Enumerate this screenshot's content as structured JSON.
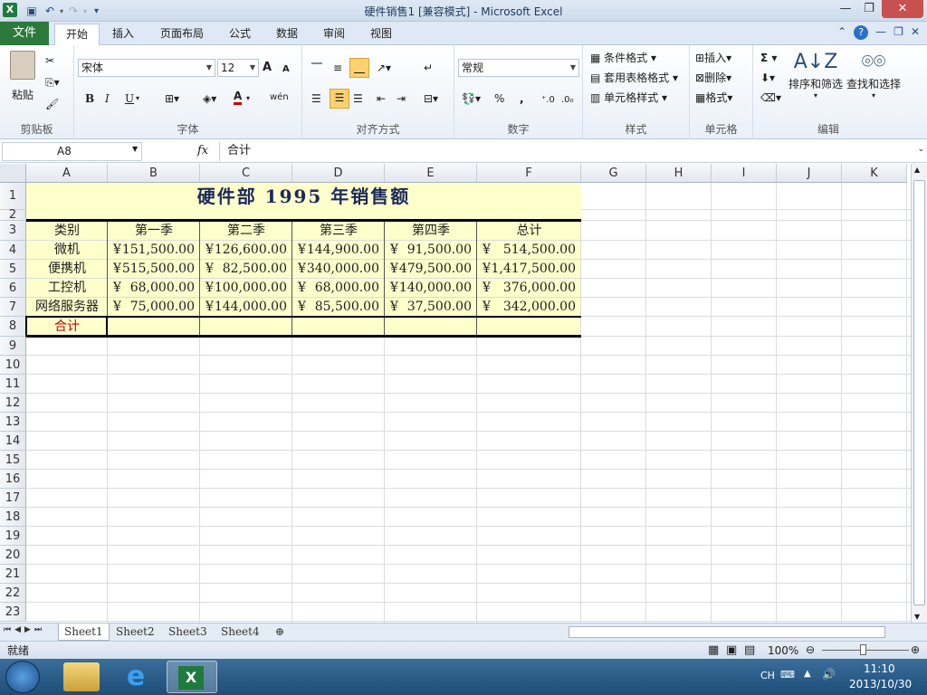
{
  "window": {
    "title": "硬件销售1 [兼容模式] - Microsoft Excel",
    "app_icon": "X",
    "minimize": "—",
    "restore": "❐",
    "close": "✕"
  },
  "quick_access": {
    "save": "save-icon",
    "undo": "undo-icon",
    "redo": "redo-icon",
    "customize": "▾"
  },
  "tabs": [
    {
      "label": "文件"
    },
    {
      "label": "开始"
    },
    {
      "label": "插入"
    },
    {
      "label": "页面布局"
    },
    {
      "label": "公式"
    },
    {
      "label": "数据"
    },
    {
      "label": "审阅"
    },
    {
      "label": "视图"
    }
  ],
  "ribbon": {
    "clipboard": {
      "paste": "粘贴",
      "label": "剪贴板"
    },
    "font": {
      "name": "宋体",
      "size": "12",
      "bold": "B",
      "italic": "I",
      "underline": "U",
      "label": "字体",
      "grow": "A",
      "shrink": "A",
      "font_color": "A",
      "phonetic": "wén"
    },
    "alignment": {
      "label": "对齐方式"
    },
    "number": {
      "format": "常规",
      "percent": "%",
      "comma": ",",
      "label": "数字"
    },
    "styles": {
      "conditional": "条件格式",
      "table": "套用表格格式",
      "cell_styles": "单元格样式",
      "label": "样式"
    },
    "cells": {
      "insert": "插入",
      "delete": "删除",
      "format": "格式",
      "label": "单元格"
    },
    "editing": {
      "sum": "Σ",
      "sort": "排序和筛选",
      "find": "查找和选择",
      "label": "编辑"
    }
  },
  "formula_bar": {
    "name_box": "A8",
    "fx": "fx",
    "content": "合计"
  },
  "columns": [
    "A",
    "B",
    "C",
    "D",
    "E",
    "F",
    "G",
    "H",
    "I",
    "J",
    "K"
  ],
  "rows": [
    "1",
    "2",
    "3",
    "4",
    "5",
    "6",
    "7",
    "8",
    "9",
    "10",
    "11",
    "12",
    "13",
    "14",
    "15",
    "16",
    "17",
    "18",
    "19",
    "20",
    "21",
    "22",
    "23"
  ],
  "sheet": {
    "title": "硬件部 1995 年销售额",
    "headers": [
      "类别",
      "第一季",
      "第二季",
      "第三季",
      "第四季",
      "总计"
    ],
    "currency_symbol": "¥",
    "data": [
      {
        "category": "微机",
        "values": [
          "151,500.00",
          "126,600.00",
          "144,900.00",
          "91,500.00",
          "514,500.00"
        ]
      },
      {
        "category": "便携机",
        "values": [
          "515,500.00",
          "82,500.00",
          "340,000.00",
          "479,500.00",
          "1,417,500.00"
        ]
      },
      {
        "category": "工控机",
        "values": [
          "68,000.00",
          "100,000.00",
          "68,000.00",
          "140,000.00",
          "376,000.00"
        ]
      },
      {
        "category": "网络服务器",
        "values": [
          "75,000.00",
          "144,000.00",
          "85,500.00",
          "37,500.00",
          "342,000.00"
        ]
      }
    ],
    "total_label": "合计",
    "total_color": "#c00000",
    "highlight_color": "#ffffcc"
  },
  "sheet_tabs": [
    "Sheet1",
    "Sheet2",
    "Sheet3",
    "Sheet4"
  ],
  "status": {
    "ready": "就绪",
    "zoom": "100%"
  },
  "taskbar": {
    "lang": "CH",
    "time": "11:10",
    "date": "2013/10/30"
  }
}
